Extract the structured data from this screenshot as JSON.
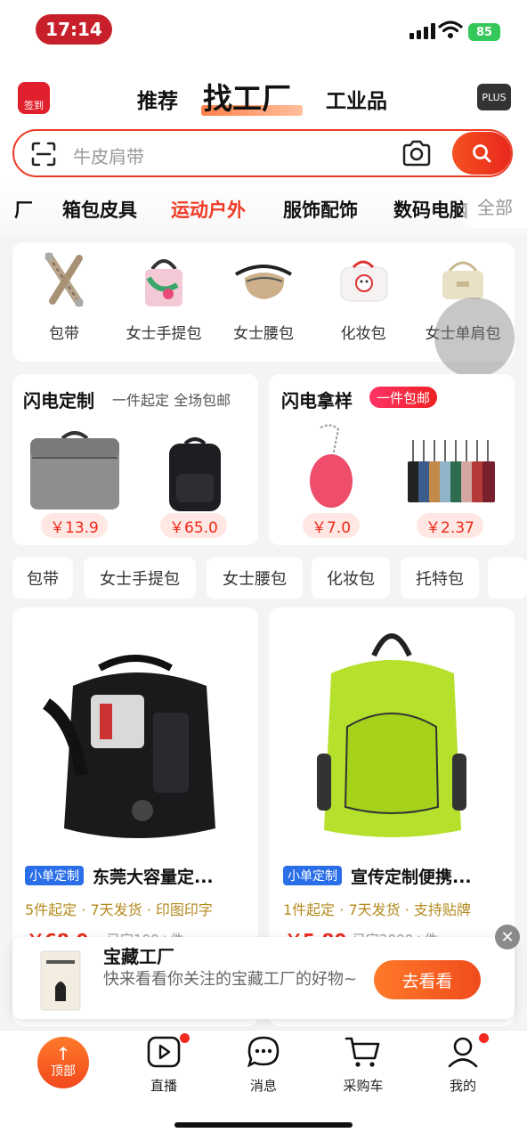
{
  "status": {
    "time": "17:14",
    "battery": "85"
  },
  "header": {
    "signin_label": "签到",
    "tabs": [
      "推荐",
      "找工厂",
      "工业品"
    ],
    "plus_label": "PLUS"
  },
  "search": {
    "placeholder": "牛皮肩带"
  },
  "categories": [
    "厂",
    "箱包皮具",
    "运动户外",
    "服饰配饰",
    "数码电脑"
  ],
  "categories_all": "全部",
  "sub_categories": [
    "包带",
    "女士手提包",
    "女士腰包",
    "化妆包",
    "女士单肩包"
  ],
  "flash_custom": {
    "title": "闪电定制",
    "subtitle": "一件起定 全场包邮",
    "prices": [
      "￥13.9",
      "￥65.0"
    ]
  },
  "flash_sample": {
    "title": "闪电拿样",
    "badge": "一件包邮",
    "prices": [
      "￥7.0",
      "￥2.37"
    ]
  },
  "chips": [
    "包带",
    "女士手提包",
    "女士腰包",
    "化妆包",
    "托特包"
  ],
  "products": [
    {
      "tag": "小单定制",
      "title": "东莞大容量定...",
      "meta": "5件起定 · 7天发货 · 印图印字",
      "price": "￥68.0",
      "sold": "已定100+件"
    },
    {
      "tag": "小单定制",
      "title": "宣传定制便携...",
      "meta": "1件起定 · 7天发货 · 支持贴牌",
      "price": "￥5.80",
      "sold": "已定2000+件"
    }
  ],
  "banner": {
    "title": "宝藏工厂",
    "subtitle": "快来看看你关注的宝藏工厂的好物~",
    "button": "去看看"
  },
  "tabbar": {
    "top_label": "顶部",
    "items": [
      "直播",
      "消息",
      "采购车",
      "我的"
    ]
  },
  "colors": {
    "accent": "#ee3b25",
    "tag_blue": "#2b6fe8",
    "meta_gold": "#b48a1e"
  }
}
